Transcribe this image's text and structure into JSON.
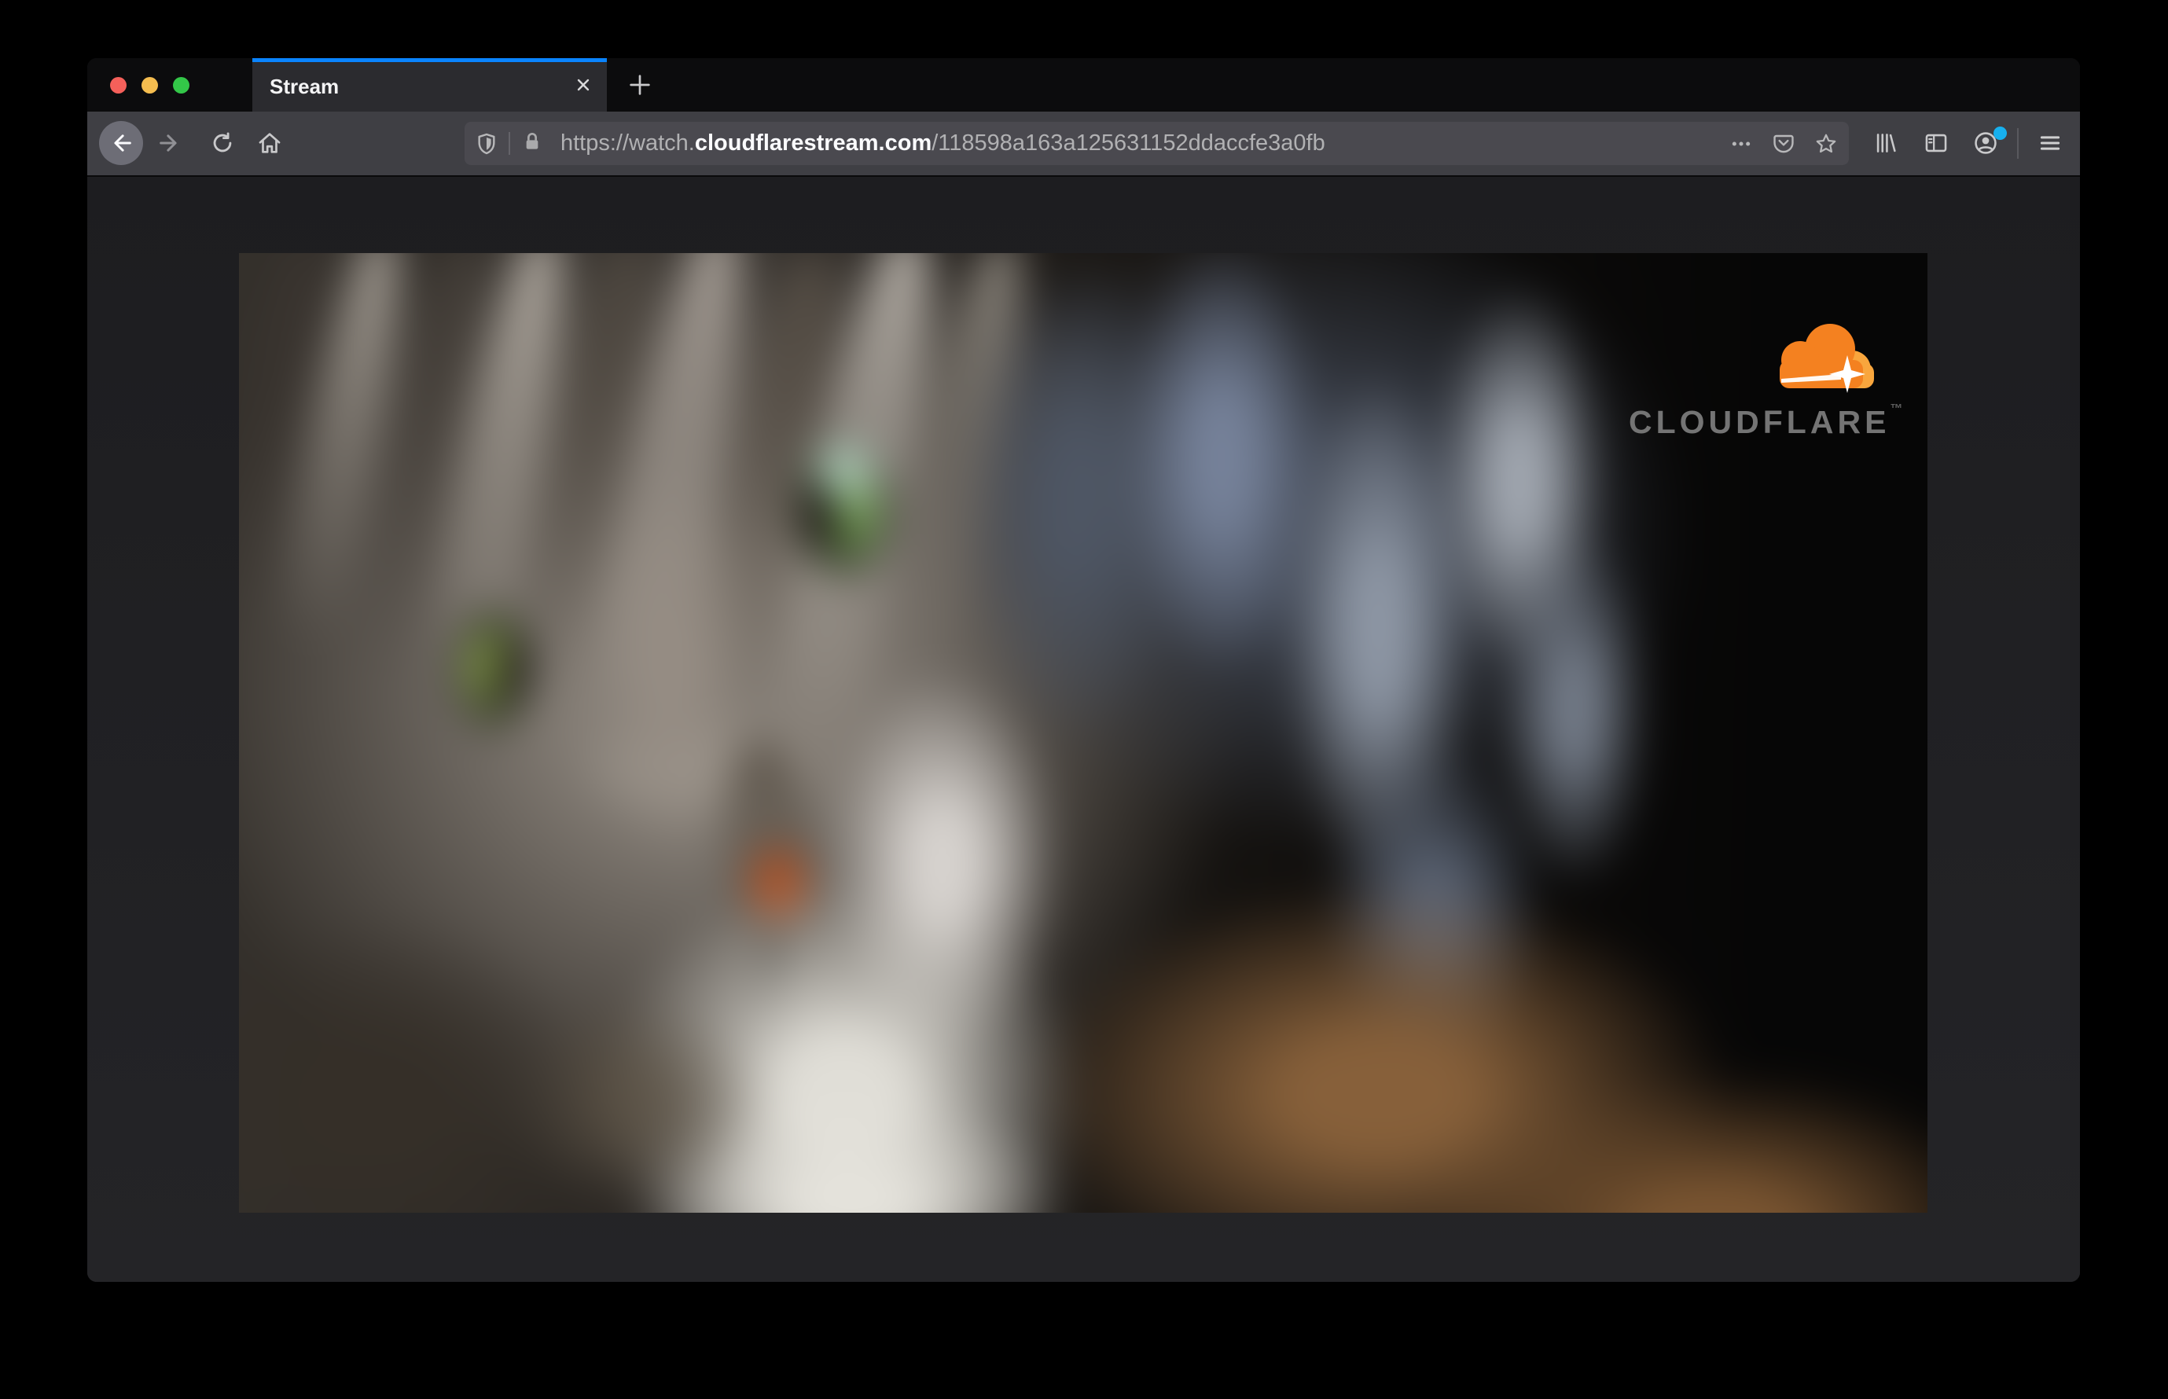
{
  "tabbar": {
    "tab": {
      "title": "Stream"
    }
  },
  "urlbar": {
    "protocol_subdomain": "https://watch.",
    "domain": "cloudflarestream.com",
    "path": "/118598a163a125631152ddaccfe3a0fb"
  },
  "video": {
    "logo_text": "CLOUDFLARE",
    "logo_trademark": "™"
  },
  "icons": {
    "window_close": "red-circle",
    "window_minimize": "yellow-circle",
    "window_zoom": "green-circle",
    "close_tab": "x",
    "new_tab": "plus",
    "back": "left-arrow",
    "forward": "right-arrow",
    "reload": "circular-arrow",
    "home": "house",
    "tracking_protection": "shield",
    "connection_secure": "lock",
    "page_actions": "ellipsis",
    "pocket": "pocket-badge",
    "bookmark": "star",
    "library": "books",
    "sidebar": "split-panel",
    "account": "person-circle",
    "menu": "hamburger"
  },
  "colors": {
    "accent_blue": "#0a84ff",
    "traffic_red": "#f5605a",
    "traffic_yellow": "#f5bd4f",
    "traffic_green": "#33c748",
    "notification_dot": "#17b0ee",
    "cloudflare_orange": "#f48120",
    "cloudflare_orange_light": "#f9a63d",
    "toolbar_bg": "#3f3f44",
    "urlbar_bg": "#4a494f",
    "tabbar_bg": "#0c0c0d"
  }
}
